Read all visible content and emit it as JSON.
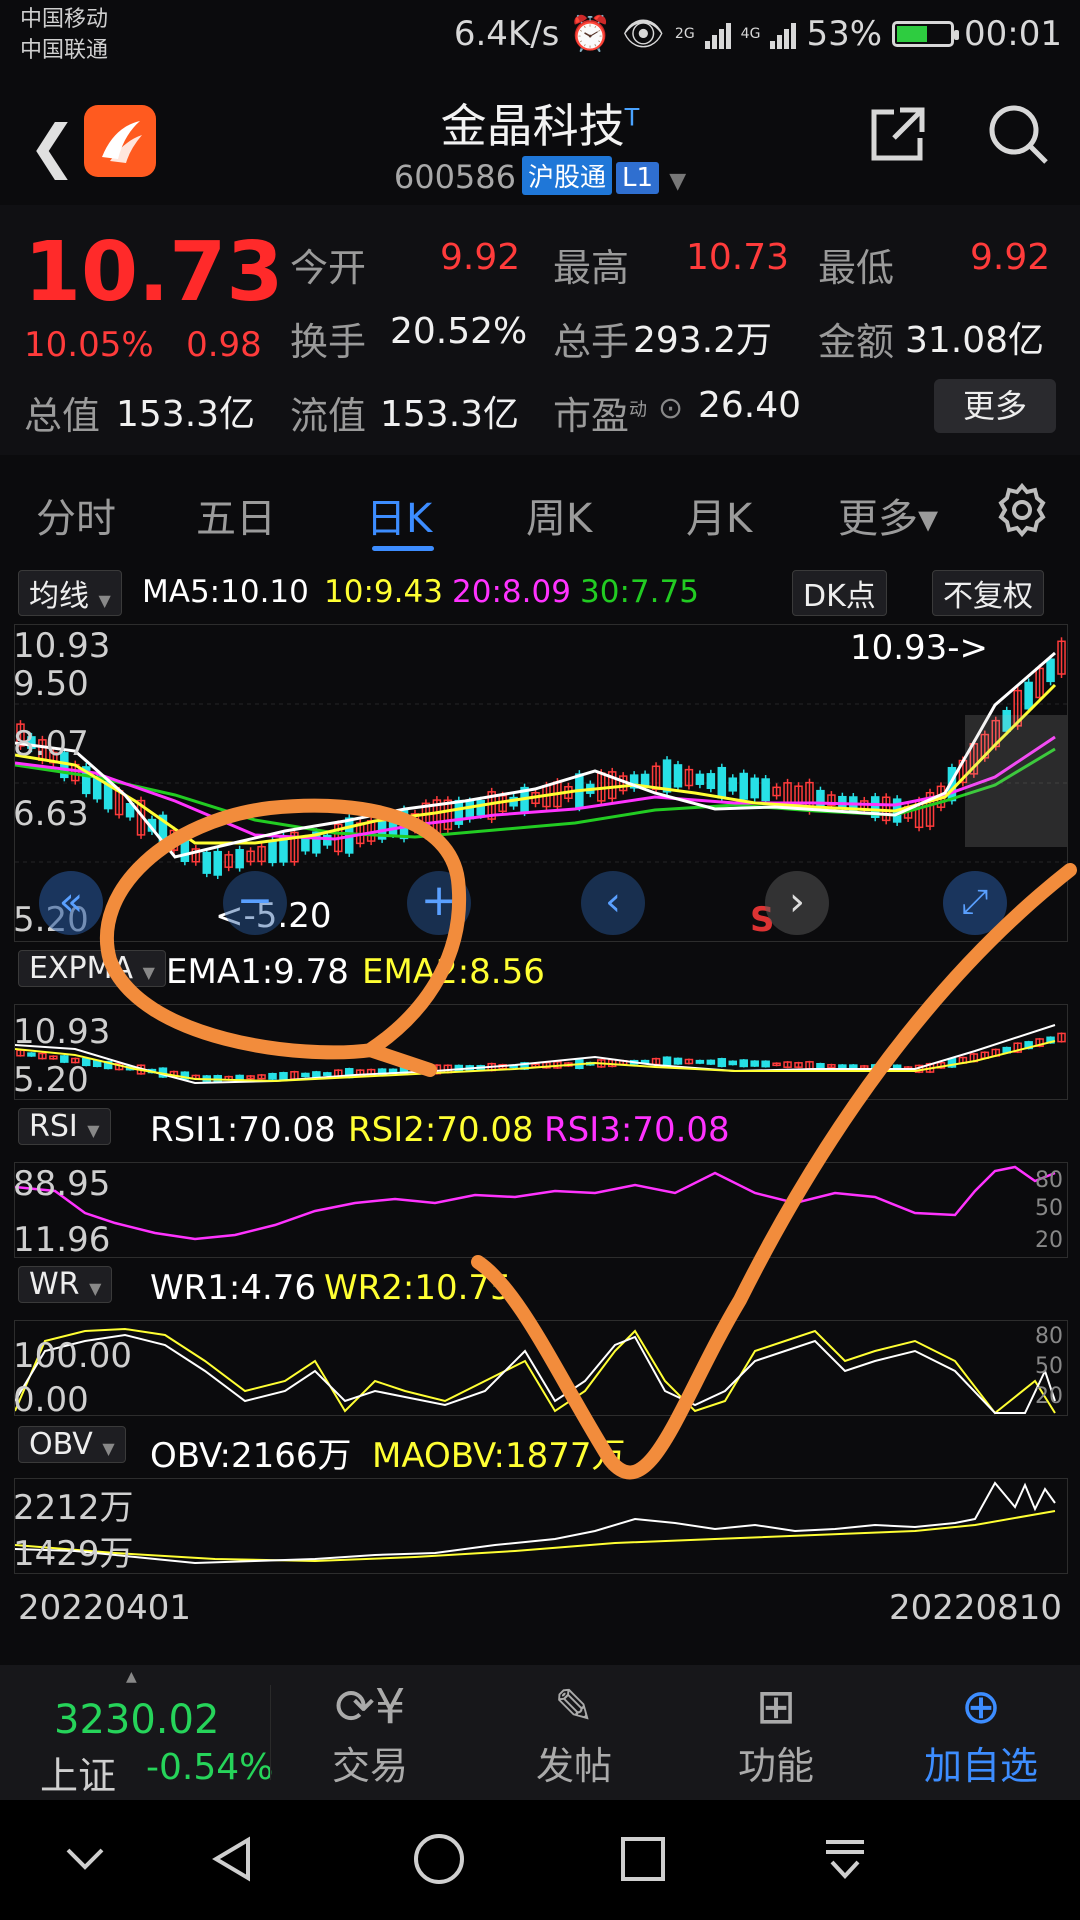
{
  "status": {
    "carrier1": "中国移动",
    "carrier2": "中国联通",
    "speed": "6.4K/s",
    "net1": "2G",
    "net2": "4G",
    "battery": "53%",
    "time": "00:01"
  },
  "header": {
    "title": "金晶科技",
    "title_mark": "T",
    "code": "600586",
    "tag1": "沪股通",
    "tag2": "L1"
  },
  "quote": {
    "price": "10.73",
    "pct": "10.05%",
    "chg": "0.98",
    "open_label": "今开",
    "open": "9.92",
    "high_label": "最高",
    "high": "10.73",
    "low_label": "最低",
    "low": "9.92",
    "turnover_label": "换手",
    "turnover": "20.52%",
    "volume_label": "总手",
    "volume": "293.2万",
    "amount_label": "金额",
    "amount": "31.08亿",
    "mcap_label": "总值",
    "mcap": "153.3亿",
    "float_label": "流值",
    "float": "153.3亿",
    "pe_label": "市盈",
    "pe_sup": "动",
    "pe": "26.40",
    "more": "更多"
  },
  "tabs": [
    {
      "label": "分时"
    },
    {
      "label": "五日"
    },
    {
      "label": "日K"
    },
    {
      "label": "周K"
    },
    {
      "label": "月K"
    },
    {
      "label": "更多▾"
    }
  ],
  "ma": {
    "dropdown": "均线",
    "ma5": "MA5:10.10",
    "ma10": "10:9.43",
    "ma20": "20:8.09",
    "ma30": "30:7.75",
    "dk": "DK点",
    "fq": "不复权"
  },
  "kline": {
    "y1": "10.93",
    "y2": "9.50",
    "y3": "8.07",
    "y4": "6.63",
    "y5": "5.20",
    "max_label": "10.93->",
    "min_label": "<-5.20",
    "s_mark": "S"
  },
  "expma": {
    "dropdown": "EXPMA",
    "ema1": "EMA1:9.78",
    "ema2": "EMA2:8.56",
    "y1": "10.93",
    "y2": "5.20"
  },
  "rsi": {
    "dropdown": "RSI",
    "rsi1": "RSI1:70.08",
    "rsi2": "RSI2:70.08",
    "rsi3": "RSI3:70.08",
    "y1": "88.95",
    "y2": "11.96",
    "r1": "80",
    "r2": "50",
    "r3": "20"
  },
  "wr": {
    "dropdown": "WR",
    "wr1": "WR1:4.76",
    "wr2": "WR2:10.75",
    "y1": "100.00",
    "y2": "0.00",
    "r1": "80",
    "r2": "50",
    "r3": "20"
  },
  "obv": {
    "dropdown": "OBV",
    "obv": "OBV:2166万",
    "maobv": "MAOBV:1877万",
    "y1": "2212万",
    "y2": "1429万"
  },
  "dates": {
    "start": "20220401",
    "end": "20220810"
  },
  "bottom": {
    "index_value": "3230.02",
    "index_name": "上证",
    "index_pct": "-0.54%",
    "trade": "交易",
    "post": "发帖",
    "func": "功能",
    "add": "加自选"
  },
  "colors": {
    "up": "#ff3b3b",
    "down": "#27e0e6",
    "ma5": "#ffffff",
    "ma10": "#ffff33",
    "ma20": "#ff33ff",
    "ma30": "#22cc22",
    "accent": "#3d8dff",
    "annot": "#f28c3c"
  }
}
